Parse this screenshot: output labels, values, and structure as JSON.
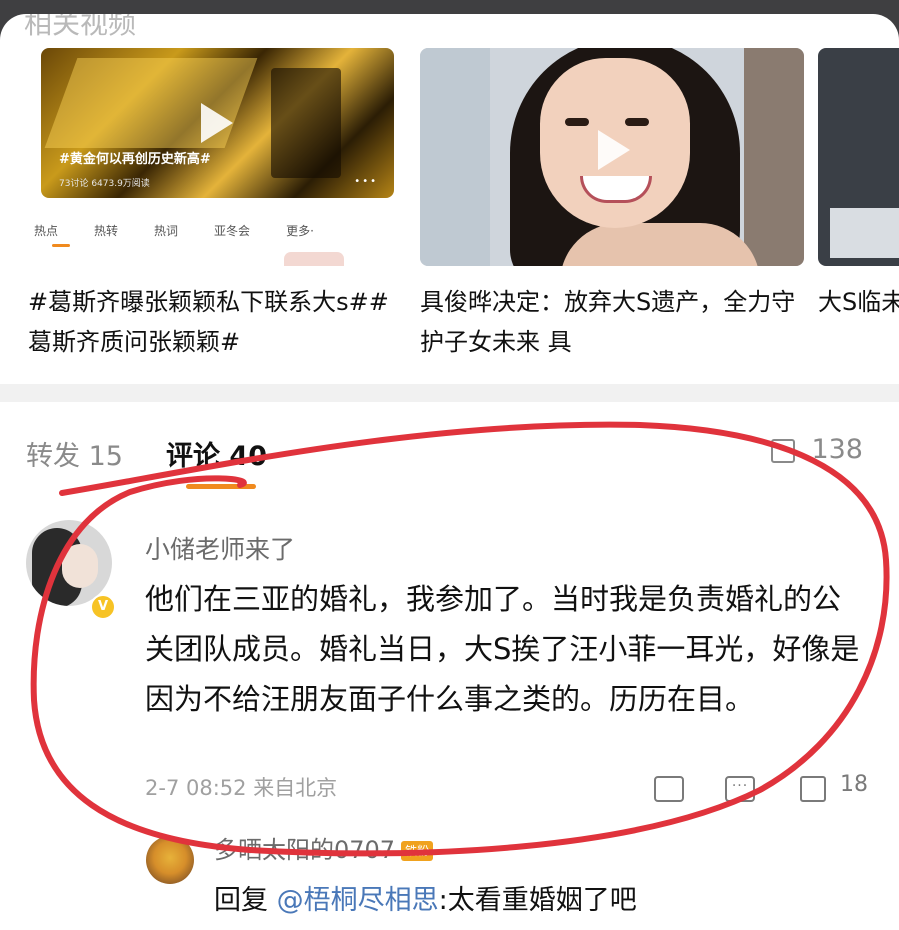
{
  "section_title": "相关视频",
  "videos": [
    {
      "thumb_caption": "#黄金何以再创历史新高#",
      "thumb_stats": "73讨论   6473.9万阅读",
      "thumb_tabs": [
        "热点",
        "热转",
        "热词",
        "亚冬会",
        "更多·"
      ],
      "title": "#葛斯齐曝张颖颖私下联系大s##葛斯齐质问张颖颖#"
    },
    {
      "title": "具俊晔决定：放弃大S遗产，全力守护子女未来 具"
    },
    {
      "title": "大S临未提汪"
    }
  ],
  "tabs": {
    "repost_label": "转发",
    "repost_count": "15",
    "comment_label": "评论",
    "comment_count": "40",
    "like_count": "138"
  },
  "comment": {
    "username": "小储老师来了",
    "text": "他们在三亚的婚礼，我参加了。当时我是负责婚礼的公关团队成员。婚礼当日，大S挨了汪小菲一耳光，好像是因为不给汪朋友面子什么事之类的。历历在目。",
    "time": "2-7 08:52",
    "location": "来自北京",
    "like_count": "18",
    "verified_badge": "V"
  },
  "reply": {
    "username": "多晒太阳的0707",
    "badge": "铁粉",
    "prefix": "回复 ",
    "mention": "@梧桐尽相思",
    "text": ":太看重婚姻了吧"
  },
  "colors": {
    "accent": "#f08a1e",
    "annotation_red": "#e0333c",
    "mention": "#4a78b8",
    "page_bg": "#3f3f41"
  },
  "icons": [
    "play-icon",
    "thumb-up-icon",
    "share-icon",
    "comment-icon",
    "verified-icon"
  ]
}
